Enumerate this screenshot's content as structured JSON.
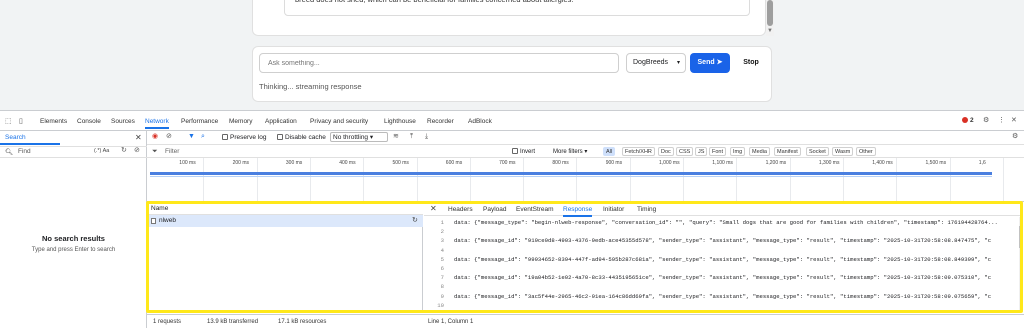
{
  "chat": {
    "message_tail": "breed does not shed, which can be beneficial for families concerned about allergies.",
    "input_placeholder": "Ask something...",
    "selected_site": "DogBreeds",
    "send_label": "Send",
    "send_icon": "paper-plane-icon",
    "stop_label": "Stop",
    "status_text": "Thinking... streaming response"
  },
  "devtools": {
    "tabs": [
      "Elements",
      "Console",
      "Sources",
      "Network",
      "Performance",
      "Memory",
      "Application",
      "Privacy and security",
      "Lighthouse",
      "Recorder",
      "AdBlock"
    ],
    "active_tab": "Network",
    "error_count": "2",
    "search": {
      "tab_label": "Search",
      "find_placeholder": "Find",
      "regex_label": "(.*)",
      "case_label": "Aa",
      "empty_title": "No search results",
      "empty_hint": "Type and press Enter to search"
    },
    "toolbar": {
      "preserve_log": "Preserve log",
      "disable_cache": "Disable cache",
      "throttling": "No throttling"
    },
    "filter": {
      "placeholder": "Filter",
      "invert": "Invert",
      "more_filters": "More filters",
      "types": [
        "All",
        "Fetch/XHR",
        "Doc",
        "CSS",
        "JS",
        "Font",
        "Img",
        "Media",
        "Manifest",
        "Socket",
        "Wasm",
        "Other"
      ],
      "active_type": "All"
    },
    "timeline_ticks": [
      "100 ms",
      "200 ms",
      "300 ms",
      "400 ms",
      "500 ms",
      "600 ms",
      "700 ms",
      "800 ms",
      "900 ms",
      "1,000 ms",
      "1,100 ms",
      "1,200 ms",
      "1,300 ms",
      "1,400 ms",
      "1,500 ms",
      "1,6"
    ],
    "requests": {
      "column_name": "Name",
      "rows": [
        {
          "name": "nlweb"
        }
      ]
    },
    "detail_tabs": [
      "Headers",
      "Payload",
      "EventStream",
      "Response",
      "Initiator",
      "Timing"
    ],
    "active_detail_tab": "Response",
    "response_lines": [
      {
        "n": "1",
        "text": "data: {\"message_type\": \"begin-nlweb-response\", \"conversation_id\": \"\", \"query\": \"Small dogs that are good for families with children\", \"timestamp\": 176194428764..."
      },
      {
        "n": "2",
        "text": ""
      },
      {
        "n": "3",
        "text": "data: {\"message_id\": \"919ce0d8-4903-4376-9edb-ace45355d578\", \"sender_type\": \"assistant\", \"message_type\": \"result\", \"timestamp\": \"2025-10-31T20:58:08.847475\", \"c"
      },
      {
        "n": "4",
        "text": ""
      },
      {
        "n": "5",
        "text": "data: {\"message_id\": \"99934652-8394-447f-ad94-595b287c681a\", \"sender_type\": \"assistant\", \"message_type\": \"result\", \"timestamp\": \"2025-10-31T20:58:08.849399\", \"c"
      },
      {
        "n": "6",
        "text": ""
      },
      {
        "n": "7",
        "text": "data: {\"message_id\": \"19a04b52-1e02-4a70-8c33-4435195651ce\", \"sender_type\": \"assistant\", \"message_type\": \"result\", \"timestamp\": \"2025-10-31T20:58:09.075310\", \"c"
      },
      {
        "n": "8",
        "text": ""
      },
      {
        "n": "9",
        "text": "data: {\"message_id\": \"3ac5f44e-2965-46c2-91ea-164c86dd69fa\", \"sender_type\": \"assistant\", \"message_type\": \"result\", \"timestamp\": \"2025-10-31T20:58:09.075659\", \"c"
      },
      {
        "n": "10",
        "text": ""
      }
    ],
    "status": {
      "requests": "1 requests",
      "transferred": "13.9 kB transferred",
      "resources": "17.1 kB resources",
      "cursor": "Line 1, Column 1"
    }
  }
}
